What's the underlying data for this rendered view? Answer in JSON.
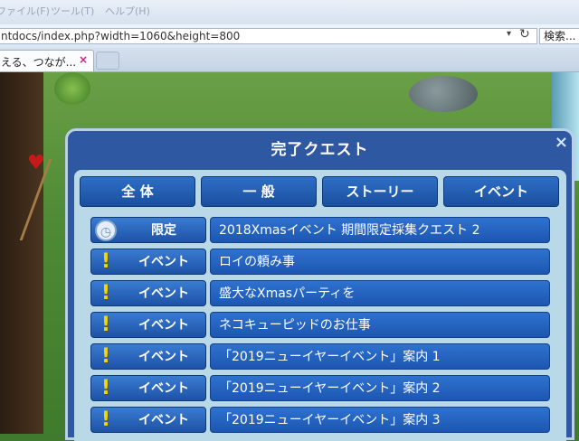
{
  "browser": {
    "menu": [
      "ファイル(F)",
      "ツール(T)",
      "ヘルプ(H)"
    ],
    "url": "ntdocs/index.php?width=1060&height=800",
    "search_placeholder": "検索...",
    "tab_title": "える、つなが...",
    "tab_close": "×"
  },
  "window": {
    "title": "完了クエスト",
    "close": "×"
  },
  "filter_tabs": [
    "全 体",
    "一 般",
    "ストーリー",
    "イベント"
  ],
  "quests": [
    {
      "category": "限定",
      "icon": "clock-icon",
      "title": "2018Xmasイベント 期間限定採集クエスト 2"
    },
    {
      "category": "イベント",
      "icon": "exclamation-icon",
      "title": "ロイの頼み事"
    },
    {
      "category": "イベント",
      "icon": "exclamation-icon",
      "title": "盛大なXmasパーティを"
    },
    {
      "category": "イベント",
      "icon": "exclamation-icon",
      "title": "ネコキューピッドのお仕事"
    },
    {
      "category": "イベント",
      "icon": "exclamation-icon",
      "title": "「2019ニューイヤーイベント」案内 1"
    },
    {
      "category": "イベント",
      "icon": "exclamation-icon",
      "title": "「2019ニューイヤーイベント」案内 2"
    },
    {
      "category": "イベント",
      "icon": "exclamation-icon",
      "title": "「2019ニューイヤーイベント」案内 3"
    }
  ]
}
